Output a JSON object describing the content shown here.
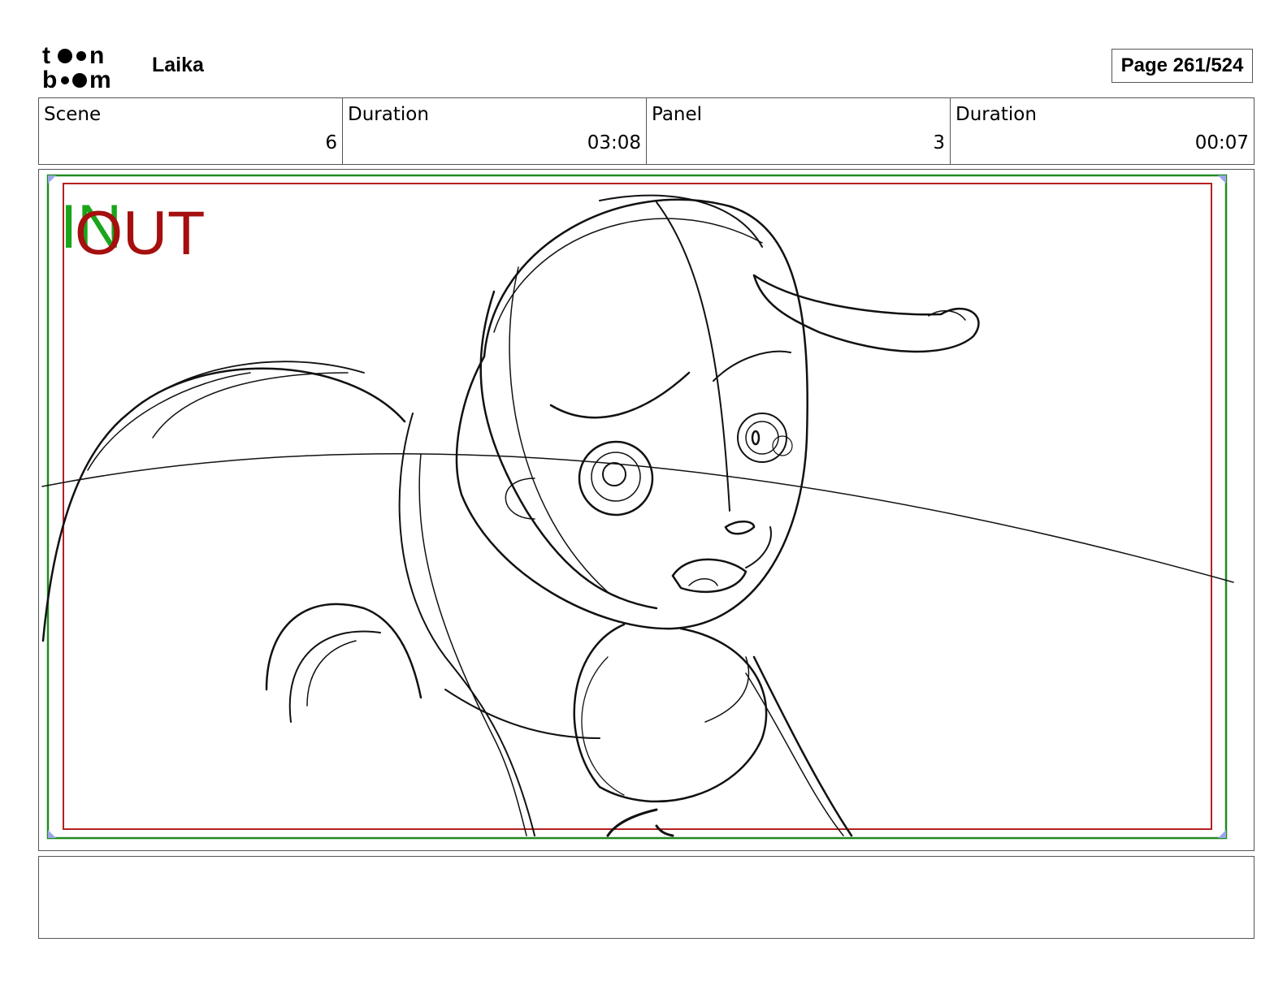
{
  "header": {
    "logo_text": "toon boom",
    "project_name": "Laika",
    "page_label": "Page 261/524"
  },
  "info": {
    "scene_label": "Scene",
    "scene_value": "6",
    "scene_duration_label": "Duration",
    "scene_duration_value": "03:08",
    "panel_label": "Panel",
    "panel_value": "3",
    "panel_duration_label": "Duration",
    "panel_duration_value": "00:07"
  },
  "panel": {
    "in_marker": "IN",
    "out_marker": "OUT",
    "in_color": "#1aa51a",
    "out_color": "#a50f0f",
    "safe_frame_color": "#b42020",
    "action_frame_color": "#208a20"
  },
  "notes": {
    "text": ""
  }
}
